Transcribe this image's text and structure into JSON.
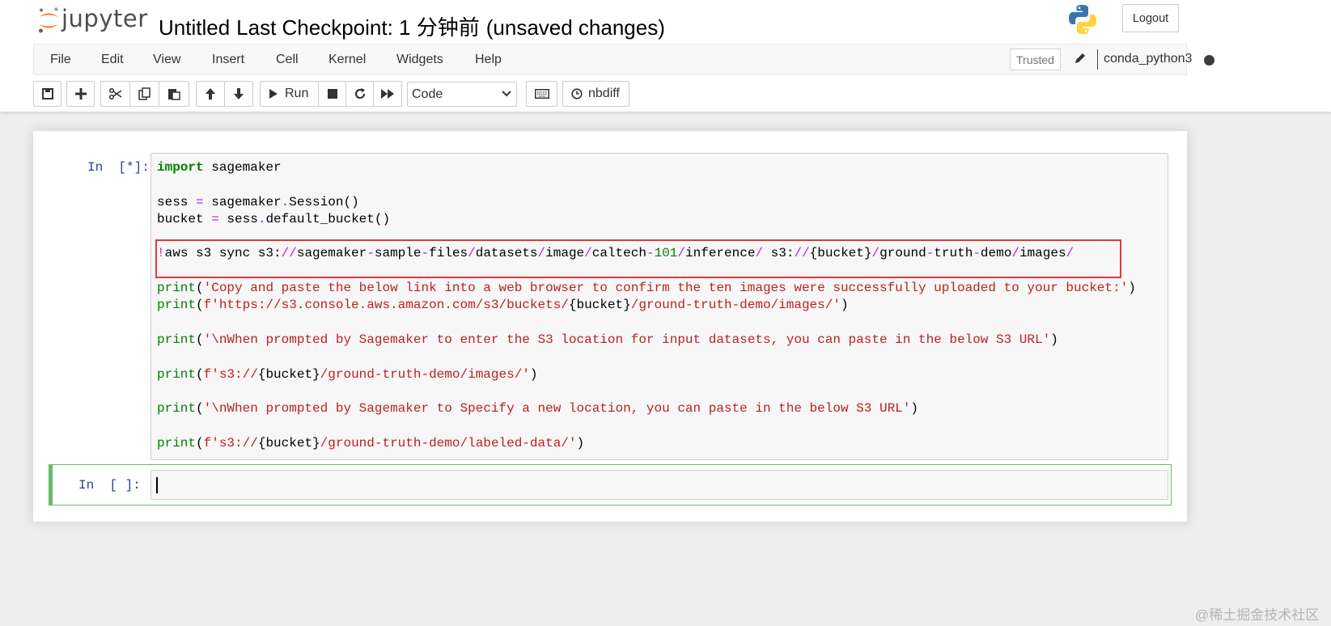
{
  "header": {
    "logo_text": "jupyter",
    "notebook_name": "Untitled",
    "checkpoint": "Last Checkpoint: 1 分钟前",
    "save_status": "(unsaved changes)",
    "logout_label": "Logout"
  },
  "menu": {
    "items": [
      "File",
      "Edit",
      "View",
      "Insert",
      "Cell",
      "Kernel",
      "Widgets",
      "Help"
    ],
    "trusted_label": "Trusted",
    "kernel_name": "conda_python3"
  },
  "toolbar": {
    "run_label": "Run",
    "cell_type": "Code",
    "nbdiff_label": "nbdiff",
    "icons": [
      "save-icon",
      "plus-icon",
      "cut-icon",
      "copy-icon",
      "paste-icon",
      "arrow-up-icon",
      "arrow-down-icon",
      "play-icon",
      "stop-icon",
      "restart-icon",
      "fast-forward-icon",
      "keyboard-icon",
      "history-icon"
    ]
  },
  "cells": [
    {
      "prompt": "In  [*]:",
      "code_lines": [
        "import sagemaker",
        "",
        "sess = sagemaker.Session()",
        "bucket = sess.default_bucket()",
        "",
        "!aws s3 sync s3://sagemaker-sample-files/datasets/image/caltech-101/inference/ s3://{bucket}/ground-truth-demo/images/",
        "",
        "print('Copy and paste the below link into a web browser to confirm the ten images were successfully uploaded to your bucket:')",
        "print(f'https://s3.console.aws.amazon.com/s3/buckets/{bucket}/ground-truth-demo/images/')",
        "",
        "print('\\nWhen prompted by Sagemaker to enter the S3 location for input datasets, you can paste in the below S3 URL')",
        "",
        "print(f's3://{bucket}/ground-truth-demo/images/')",
        "",
        "print('\\nWhen prompted by Sagemaker to Specify a new location, you can paste in the below S3 URL')",
        "",
        "print(f's3://{bucket}/ground-truth-demo/labeled-data/')"
      ]
    },
    {
      "prompt": "In  [ ]:",
      "code_lines": [
        ""
      ]
    }
  ],
  "watermark": "@稀土掘金技术社区",
  "colors": {
    "accent_border": "#e0393e",
    "selected_cell": "#66bb6a",
    "prompt": "#303f9f"
  }
}
